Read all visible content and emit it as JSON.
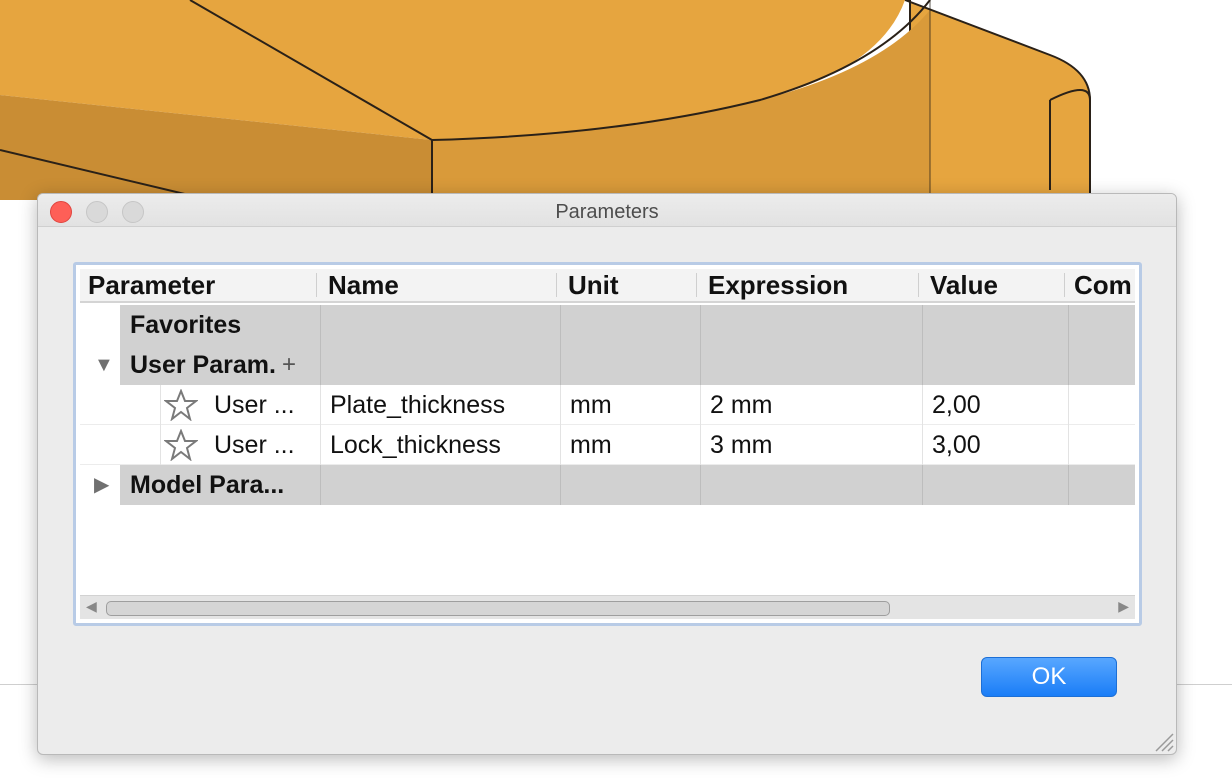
{
  "window": {
    "title": "Parameters"
  },
  "table": {
    "columns": [
      "Parameter",
      "Name",
      "Unit",
      "Expression",
      "Value",
      "Com"
    ],
    "groups": {
      "favorites": {
        "label": "Favorites"
      },
      "user_params": {
        "label": "User Param.",
        "expanded": true
      },
      "model_params": {
        "label": "Model Para...",
        "expanded": false
      }
    },
    "rows": [
      {
        "parameter": "User ...",
        "name": "Plate_thickness",
        "unit": "mm",
        "expression": "2 mm",
        "value": "2,00",
        "comment": ""
      },
      {
        "parameter": "User ...",
        "name": "Lock_thickness",
        "unit": "mm",
        "expression": "3 mm",
        "value": "3,00",
        "comment": ""
      }
    ]
  },
  "buttons": {
    "ok": "OK"
  },
  "icons": {
    "favorite": "star-icon",
    "add": "plus-icon",
    "expand": "triangle-down-icon",
    "collapse": "triangle-right-icon"
  },
  "colors": {
    "model_body": "#e4a43f",
    "ok_button": "#1a7df7",
    "close_button": "#fe5f57",
    "frame_focus": "#b8cbe6"
  }
}
